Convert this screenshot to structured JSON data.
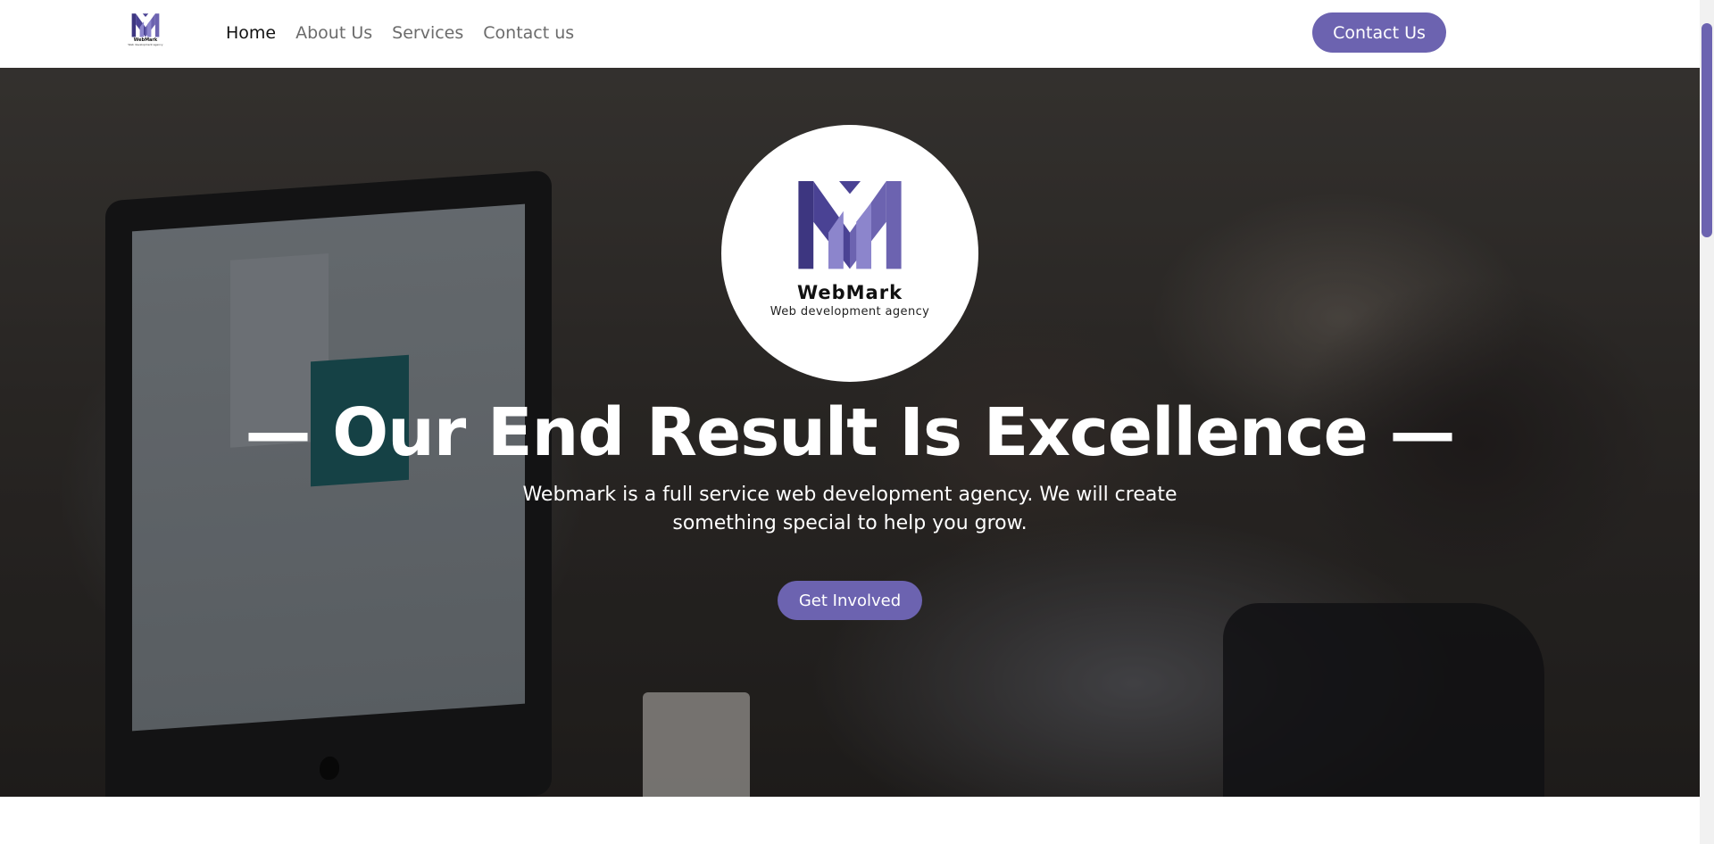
{
  "brand": {
    "name": "WebMark",
    "tagline": "Web development agency",
    "logo_icon": "webmark-logo-icon",
    "accent_color": "#6c63b0"
  },
  "nav": {
    "items": [
      {
        "label": "Home",
        "active": true
      },
      {
        "label": "About Us",
        "active": false
      },
      {
        "label": "Services",
        "active": false
      },
      {
        "label": "Contact us",
        "active": false
      }
    ],
    "cta_label": "Contact Us"
  },
  "hero": {
    "title": "— Our End Result Is Excellence —",
    "subtitle": "Webmark is a full service web development agency. We will create something special to help you grow.",
    "cta_label": "Get Involved"
  }
}
